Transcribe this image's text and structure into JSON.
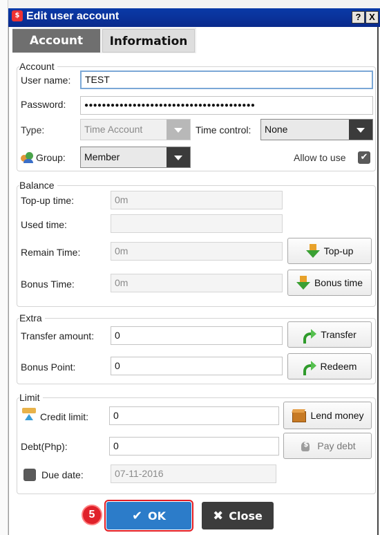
{
  "window": {
    "title": "Edit user account",
    "help_label": "?",
    "close_label": "X"
  },
  "tabs": [
    {
      "label": "Account",
      "active": true
    },
    {
      "label": "Information",
      "active": false
    }
  ],
  "account": {
    "legend": "Account",
    "username_label": "User name:",
    "username_value": "TEST",
    "password_label": "Password:",
    "password_mask": "●●●●●●●●●●●●●●●●●●●●●●●●●●●●●●●●●●●●●●●",
    "type_label": "Type:",
    "type_value": "Time Account",
    "time_control_label": "Time control:",
    "time_control_value": "None",
    "group_label": "Group:",
    "group_value": "Member",
    "allow_label": "Allow to use",
    "allow_checked": true
  },
  "balance": {
    "legend": "Balance",
    "topup_time_label": "Top-up time:",
    "topup_time_value": "0m",
    "used_time_label": "Used time:",
    "used_time_value": "",
    "remain_time_label": "Remain Time:",
    "remain_time_value": "0m",
    "bonus_time_label": "Bonus Time:",
    "bonus_time_value": "0m",
    "topup_button": "Top-up",
    "bonus_button": "Bonus time"
  },
  "extra": {
    "legend": "Extra",
    "transfer_amount_label": "Transfer amount:",
    "transfer_amount_value": "0",
    "bonus_point_label": "Bonus Point:",
    "bonus_point_value": "0",
    "transfer_button": "Transfer",
    "redeem_button": "Redeem"
  },
  "limit": {
    "legend": "Limit",
    "credit_limit_label": "Credit limit:",
    "credit_limit_value": "0",
    "debt_label": "Debt(Php):",
    "debt_value": "0",
    "due_date_label": "Due date:",
    "due_date_value": "07-11-2016",
    "lend_button": "Lend money",
    "pay_button": "Pay debt"
  },
  "footer": {
    "ok_label": "OK",
    "close_label": "Close",
    "step_badge": "5"
  },
  "colors": {
    "title_bar": "#0a3aa8",
    "ok_button": "#2c7cc9",
    "highlight": "#e11b22"
  }
}
